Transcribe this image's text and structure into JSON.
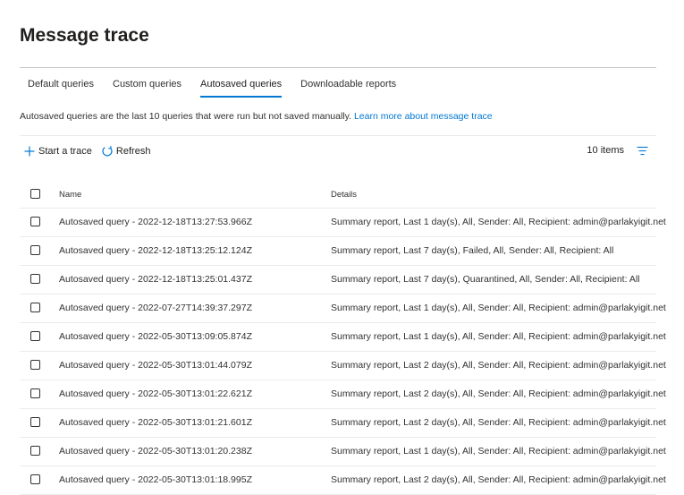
{
  "page": {
    "title": "Message trace"
  },
  "tabs": [
    {
      "label": "Default queries",
      "active": false
    },
    {
      "label": "Custom queries",
      "active": false
    },
    {
      "label": "Autosaved queries",
      "active": true
    },
    {
      "label": "Downloadable reports",
      "active": false
    }
  ],
  "description": {
    "text": "Autosaved queries are the last 10 queries that were run but not saved manually.",
    "link": "Learn more about message trace"
  },
  "toolbar": {
    "start_trace": "Start a trace",
    "refresh": "Refresh",
    "item_count": "10 items"
  },
  "table": {
    "columns": {
      "name": "Name",
      "details": "Details"
    },
    "rows": [
      {
        "name": "Autosaved query - 2022-12-18T13:27:53.966Z",
        "details": "Summary report, Last 1 day(s), All, Sender: All, Recipient: admin@parlakyigit.net"
      },
      {
        "name": "Autosaved query - 2022-12-18T13:25:12.124Z",
        "details": "Summary report, Last 7 day(s), Failed, All, Sender: All, Recipient: All"
      },
      {
        "name": "Autosaved query - 2022-12-18T13:25:01.437Z",
        "details": "Summary report, Last 7 day(s), Quarantined, All, Sender: All, Recipient: All"
      },
      {
        "name": "Autosaved query - 2022-07-27T14:39:37.297Z",
        "details": "Summary report, Last 1 day(s), All, Sender: All, Recipient: admin@parlakyigit.net"
      },
      {
        "name": "Autosaved query - 2022-05-30T13:09:05.874Z",
        "details": "Summary report, Last 1 day(s), All, Sender: All, Recipient: admin@parlakyigit.net"
      },
      {
        "name": "Autosaved query - 2022-05-30T13:01:44.079Z",
        "details": "Summary report, Last 2 day(s), All, Sender: All, Recipient: admin@parlakyigit.net"
      },
      {
        "name": "Autosaved query - 2022-05-30T13:01:22.621Z",
        "details": "Summary report, Last 2 day(s), All, Sender: All, Recipient: admin@parlakyigit.net"
      },
      {
        "name": "Autosaved query - 2022-05-30T13:01:21.601Z",
        "details": "Summary report, Last 2 day(s), All, Sender: All, Recipient: admin@parlakyigit.net"
      },
      {
        "name": "Autosaved query - 2022-05-30T13:01:20.238Z",
        "details": "Summary report, Last 1 day(s), All, Sender: All, Recipient: admin@parlakyigit.net"
      },
      {
        "name": "Autosaved query - 2022-05-30T13:01:18.995Z",
        "details": "Summary report, Last 2 day(s), All, Sender: All, Recipient: admin@parlakyigit.net"
      }
    ]
  },
  "icons": {
    "add": "add-icon",
    "refresh": "refresh-icon",
    "filter": "filter-icon"
  },
  "colors": {
    "accent": "#0078d4",
    "text": "#323130",
    "divider": "#edebe9"
  }
}
